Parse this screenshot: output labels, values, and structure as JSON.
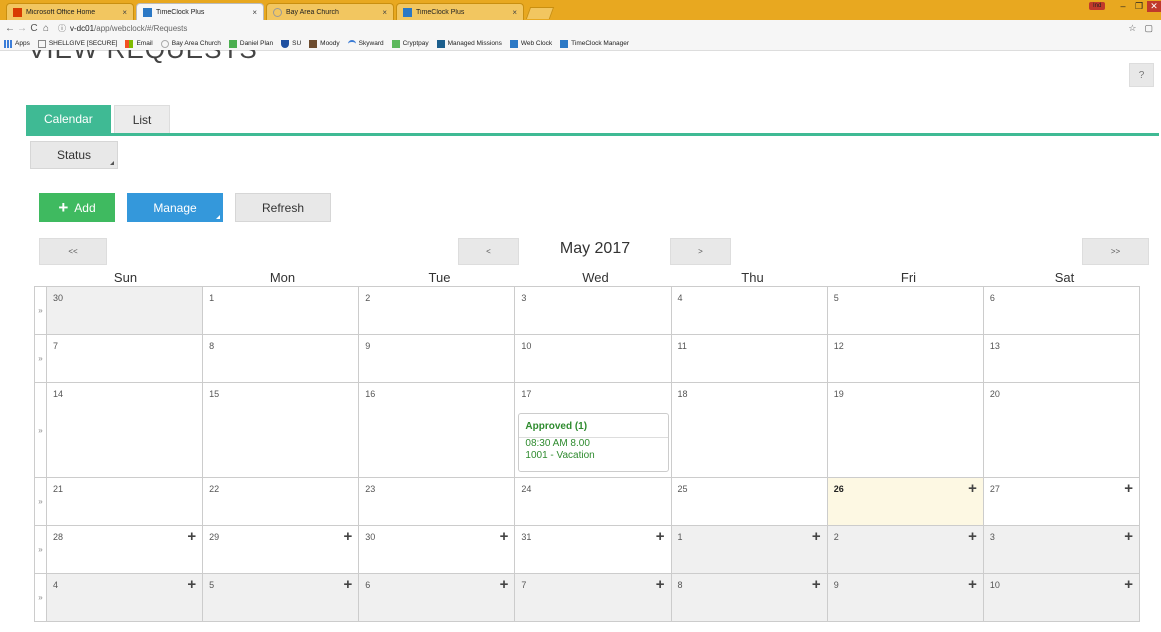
{
  "browser": {
    "tabs": [
      {
        "title": "Microsoft Office Home",
        "active": false,
        "icon": "office-icon"
      },
      {
        "title": "TimeClock Plus",
        "active": true,
        "icon": "timeclock-icon"
      },
      {
        "title": "Bay Area Church",
        "active": false,
        "icon": "church-icon"
      },
      {
        "title": "TimeClock Plus",
        "active": false,
        "icon": "timeclock-icon"
      }
    ],
    "user_badge": "Ind",
    "url_domain": "v-dc01",
    "url_path": "/app/webclock/#/Requests",
    "bookmarks": [
      "Apps",
      "SHELLGIVE [SECURE]",
      "Email",
      "Bay Area Church",
      "Daniel Plan",
      "SU",
      "Moody",
      "Skyward",
      "Cryptpay",
      "Managed Missions",
      "Web Clock",
      "TimeClock Manager"
    ]
  },
  "page": {
    "title": "VIEW REQUESTS",
    "help": "?",
    "tabs": {
      "calendar": "Calendar",
      "list": "List"
    },
    "status_button": "Status",
    "add_button": "Add",
    "manage_button": "Manage",
    "refresh_button": "Refresh"
  },
  "calendar": {
    "month": "May 2017",
    "nav": {
      "prev_year": "<<",
      "prev_month": "<",
      "next_month": ">",
      "next_year": ">>"
    },
    "days_of_week": [
      "Sun",
      "Mon",
      "Tue",
      "Wed",
      "Thu",
      "Fri",
      "Sat"
    ],
    "expander": "»",
    "weeks": [
      [
        "30",
        "1",
        "2",
        "3",
        "4",
        "5",
        "6"
      ],
      [
        "7",
        "8",
        "9",
        "10",
        "11",
        "12",
        "13"
      ],
      [
        "14",
        "15",
        "16",
        "17",
        "18",
        "19",
        "20"
      ],
      [
        "21",
        "22",
        "23",
        "24",
        "25",
        "26",
        "27"
      ],
      [
        "28",
        "29",
        "30",
        "31",
        "1",
        "2",
        "3"
      ],
      [
        "4",
        "5",
        "6",
        "7",
        "8",
        "9",
        "10"
      ]
    ],
    "event": {
      "header": "Approved (1)",
      "time": "08:30 AM 8.00",
      "code": "1001 - Vacation"
    }
  }
}
